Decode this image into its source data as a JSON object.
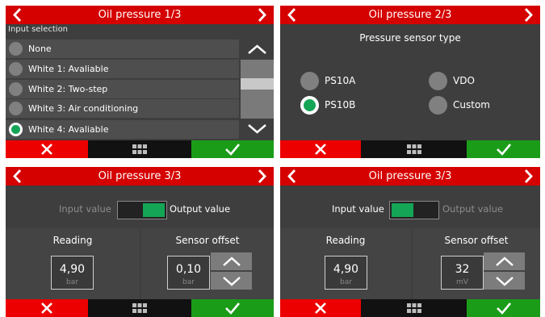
{
  "colors": {
    "header": "#d50000",
    "cancel": "#ec0000",
    "ok": "#1b9c19",
    "selected": "#14a556"
  },
  "footer": {
    "cancel_icon": "x-icon",
    "menu_icon": "grid-icon",
    "ok_icon": "check-icon"
  },
  "panel1": {
    "title": "Oil pressure 1/3",
    "subtitle": "Input selection",
    "items": [
      {
        "label": "None",
        "selected": false
      },
      {
        "label": "White 1: Avaliable",
        "selected": false
      },
      {
        "label": "White 2: Two-step",
        "selected": false
      },
      {
        "label": "White 3: Air conditioning",
        "selected": false
      },
      {
        "label": "White 4: Avaliable",
        "selected": true
      }
    ]
  },
  "panel2": {
    "title": "Oil pressure 2/3",
    "heading": "Pressure sensor type",
    "options": [
      {
        "label": "PS10A",
        "selected": false
      },
      {
        "label": "VDO",
        "selected": false
      },
      {
        "label": "PS10B",
        "selected": true
      },
      {
        "label": "Custom",
        "selected": false
      }
    ]
  },
  "panel3": {
    "title": "Oil pressure 3/3",
    "input_label": "Input value",
    "output_label": "Output value",
    "toggle_state": "output",
    "reading_label": "Reading",
    "reading_value": "4,90",
    "reading_unit": "bar",
    "offset_label": "Sensor offset",
    "offset_value": "0,10",
    "offset_unit": "bar"
  },
  "panel4": {
    "title": "Oil pressure 3/3",
    "input_label": "Input value",
    "output_label": "Output value",
    "toggle_state": "input",
    "reading_label": "Reading",
    "reading_value": "4,90",
    "reading_unit": "bar",
    "offset_label": "Sensor offset",
    "offset_value": "32",
    "offset_unit": "mV"
  }
}
